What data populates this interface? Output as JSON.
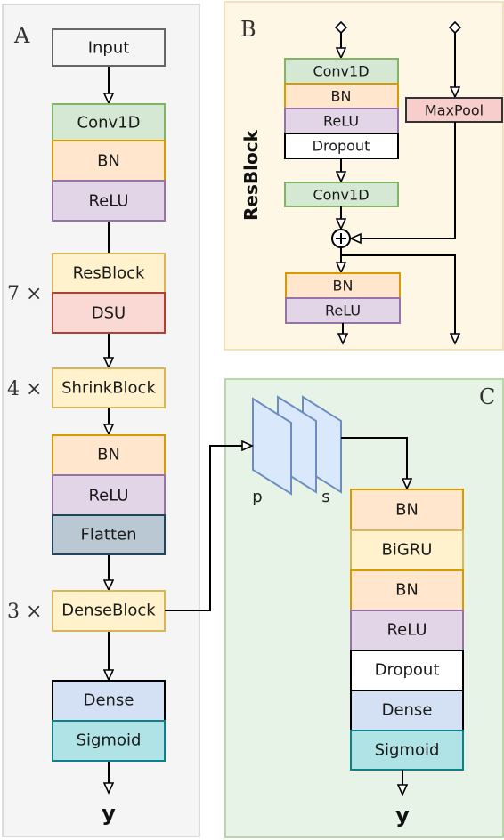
{
  "panels": {
    "A": {
      "letter": "A",
      "input_label": "Input",
      "stem": [
        "Conv1D",
        "BN",
        "ReLU"
      ],
      "res_group": {
        "multiplier": "7 ×",
        "blocks": [
          "ResBlock",
          "DSU"
        ]
      },
      "shrink_group": {
        "multiplier": "4 ×",
        "blocks": [
          "ShrinkBlock"
        ]
      },
      "post": [
        "BN",
        "ReLU",
        "Flatten"
      ],
      "dense_group": {
        "multiplier": "3 ×",
        "blocks": [
          "DenseBlock"
        ]
      },
      "head": [
        "Dense",
        "Sigmoid"
      ],
      "output": "y"
    },
    "B": {
      "letter": "B",
      "side_label": "ResBlock",
      "main_path": [
        "Conv1D",
        "BN",
        "ReLU",
        "Dropout"
      ],
      "second_conv": "Conv1D",
      "shortcut": "MaxPool",
      "add_symbol": "+",
      "post": [
        "BN",
        "ReLU"
      ]
    },
    "C": {
      "letter": "C",
      "feature_map_labels": {
        "left": "p",
        "right": "s"
      },
      "stack": [
        "BN",
        "BiGRU",
        "BN",
        "ReLU",
        "Dropout",
        "Dense",
        "Sigmoid"
      ],
      "output": "y"
    }
  },
  "colors": {
    "conv": {
      "fill": "#d5e8d4",
      "stroke": "#82b366"
    },
    "bn": {
      "fill": "#ffe6cc",
      "stroke": "#d79b00"
    },
    "relu": {
      "fill": "#e1d5e7",
      "stroke": "#9673a6"
    },
    "block": {
      "fill": "#fff2cc",
      "stroke": "#d6b656"
    },
    "dsu": {
      "fill": "#fad9d5",
      "stroke": "#ae4132"
    },
    "flatten": {
      "fill": "#bac8d3",
      "stroke": "#23445d"
    },
    "dense": {
      "fill": "#d4e1f5",
      "stroke": "#000000"
    },
    "sigmoid": {
      "fill": "#b0e3e6",
      "stroke": "#0e8088"
    },
    "dropout": {
      "fill": "#ffffff",
      "stroke": "#000000"
    },
    "maxpool": {
      "fill": "#f8cecc",
      "stroke": "#333333"
    },
    "input": {
      "fill": "#f5f5f5",
      "stroke": "#666666"
    },
    "panelA": {
      "fill": "#f5f5f5",
      "stroke": "#d0d0d0"
    },
    "panelB": {
      "fill": "#fff7e6",
      "stroke": "#f0d9a8"
    },
    "panelC": {
      "fill": "#e8f3e8",
      "stroke": "#b7d8a9"
    },
    "featuremap": {
      "fill": "#dae8fc",
      "stroke": "#6c8ebf"
    }
  }
}
